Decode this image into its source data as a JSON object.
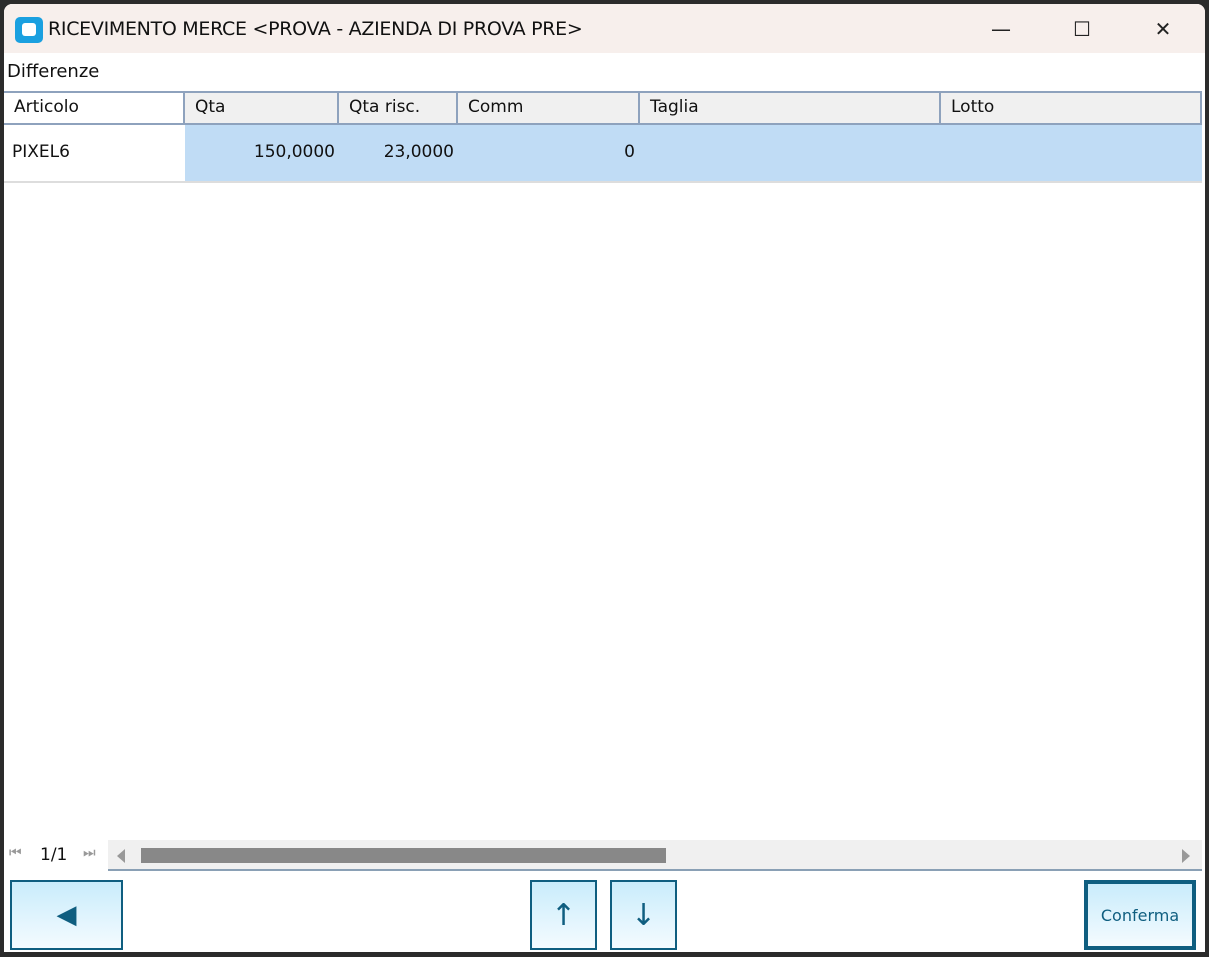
{
  "window": {
    "title": "RICEVIMENTO MERCE <PROVA - AZIENDA DI PROVA PRE>",
    "minimize": "—",
    "maximize": "☐",
    "close": "✕"
  },
  "section_label": "Differenze",
  "table": {
    "columns": [
      "Articolo",
      "Qta",
      "Qta risc.",
      "Comm",
      "Taglia",
      "Lotto"
    ],
    "rows": [
      {
        "articolo": "PIXEL6",
        "qta": "150,0000",
        "qta_risc": "23,0000",
        "comm": "0",
        "taglia": "",
        "lotto": ""
      }
    ]
  },
  "pager": {
    "first": "⏮",
    "page": "1/1",
    "last": "⏭"
  },
  "buttons": {
    "back": "◀",
    "up": "↑",
    "down": "↓",
    "confirm": "Conferma"
  }
}
